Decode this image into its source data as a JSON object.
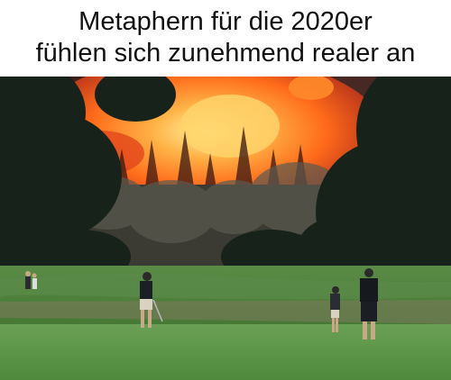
{
  "caption": {
    "line1": "Metaphern für die 2020er",
    "line2": "fühlen sich zunehmend realer an"
  },
  "photo": {
    "scene": "golf-course-wildfire",
    "colors": {
      "fire_core": "#fff2a0",
      "fire_mid": "#ff7a1c",
      "fire_outer": "#c1301a",
      "smoke": "#4a2a26",
      "fairway": "#4f8a3c",
      "rough": "#2f5c2a",
      "tree_dark": "#17231a"
    }
  }
}
